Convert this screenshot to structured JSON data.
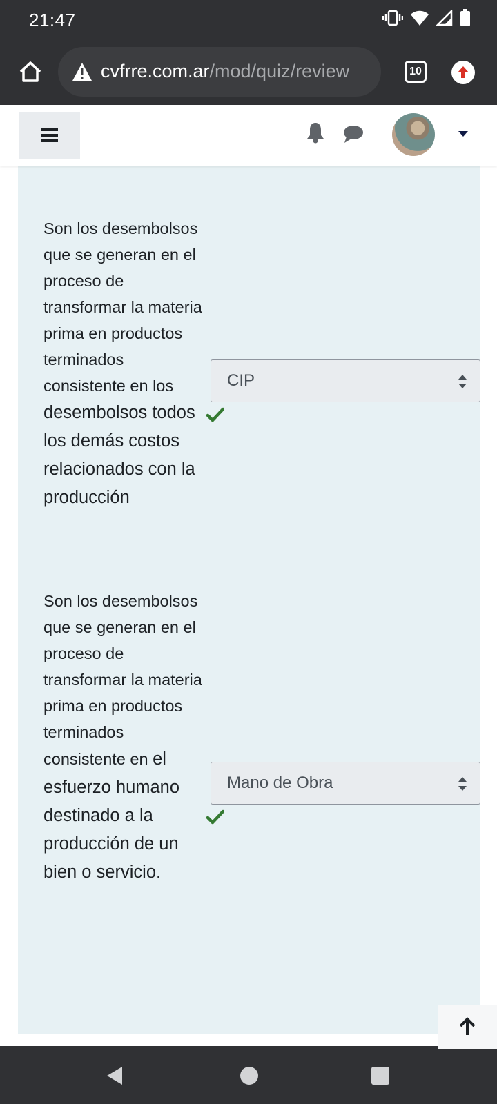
{
  "status_bar": {
    "time": "21:47",
    "icons": [
      "vibrate-icon",
      "wifi-icon",
      "signal-icon",
      "battery-icon"
    ]
  },
  "browser": {
    "url_host": "cvfrre.com.ar",
    "url_path": "/mod/quiz/review",
    "tab_count": "10",
    "icons": [
      "home-icon",
      "not-secure-warning-icon",
      "tab-switcher-icon",
      "update-available-icon"
    ]
  },
  "navbar": {
    "icons": [
      "hamburger-menu-icon",
      "notifications-bell-icon",
      "messages-chat-icon",
      "user-avatar",
      "user-menu-caret-icon"
    ]
  },
  "questions": [
    {
      "text_small": "Son los desembolsos que se generan en el proceso de transformar la materia prima en productos terminados consistente en  los",
      "text_large": "desembolsos todos los demás costos relacionados con la producción",
      "selected": "CIP",
      "correct": true
    },
    {
      "text_small": "Son los desembolsos que se generan en el proceso de transformar la materia prima en productos terminados consistente en",
      "text_large": "el esfuerzo humano destinado a la producción de un bien o servicio.",
      "selected": "Mano de Obra",
      "correct": true
    }
  ],
  "colors": {
    "system_bar": "#303134",
    "panel_background": "#e7f1f4",
    "correct_check": "#357a32",
    "select_background": "#e9ecef"
  }
}
